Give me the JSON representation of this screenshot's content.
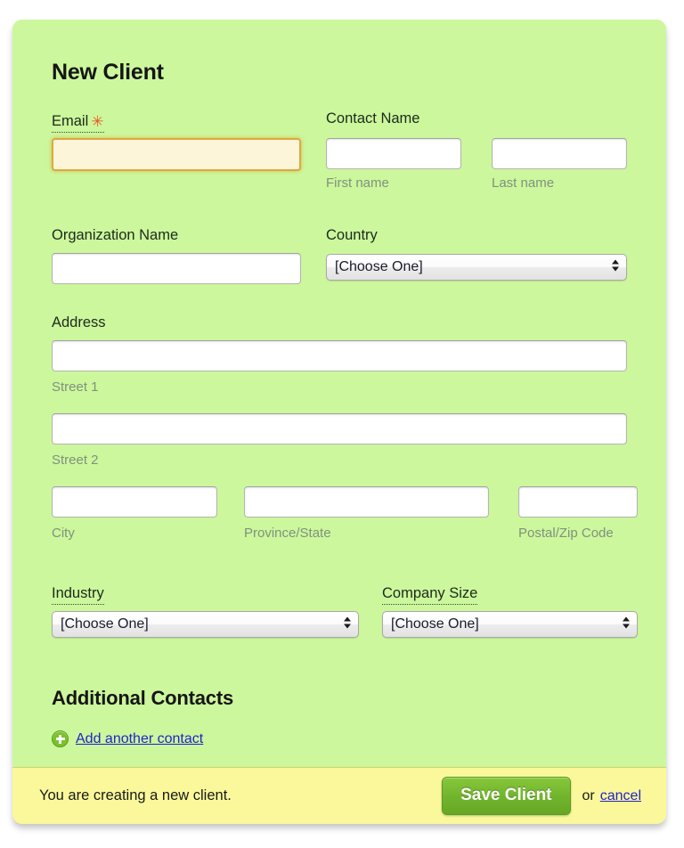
{
  "form": {
    "title": "New Client",
    "email": {
      "label": "Email",
      "required_marker": "✳",
      "value": "",
      "focused": true
    },
    "contact_name": {
      "label": "Contact Name",
      "first": {
        "value": "",
        "sub_label": "First name"
      },
      "last": {
        "value": "",
        "sub_label": "Last name"
      }
    },
    "organization": {
      "label": "Organization Name",
      "value": ""
    },
    "country": {
      "label": "Country",
      "value": "[Choose One]"
    },
    "address": {
      "label": "Address",
      "street1": {
        "value": "",
        "sub_label": "Street 1"
      },
      "street2": {
        "value": "",
        "sub_label": "Street 2"
      },
      "city": {
        "value": "",
        "sub_label": "City"
      },
      "province": {
        "value": "",
        "sub_label": "Province/State"
      },
      "postal": {
        "value": "",
        "sub_label": "Postal/Zip Code"
      }
    },
    "industry": {
      "label": "Industry",
      "value": "[Choose One]"
    },
    "company_size": {
      "label": "Company Size",
      "value": "[Choose One]"
    },
    "additional_contacts": {
      "title": "Additional Contacts",
      "add_link": "Add another contact",
      "add_icon": "plus-circle-icon"
    }
  },
  "footer": {
    "message": "You are creating a new client.",
    "save_label": "Save Client",
    "or_label": "or",
    "cancel_label": "cancel"
  },
  "colors": {
    "panel_background": "#ccf79c",
    "footer_background": "#faf89a",
    "save_button": "#72b52d",
    "link": "#2222cc",
    "required_star": "#ea5a2c",
    "focused_field_background": "#fdf5d9",
    "focused_field_border": "#dca93f",
    "sub_label": "#80917f"
  }
}
